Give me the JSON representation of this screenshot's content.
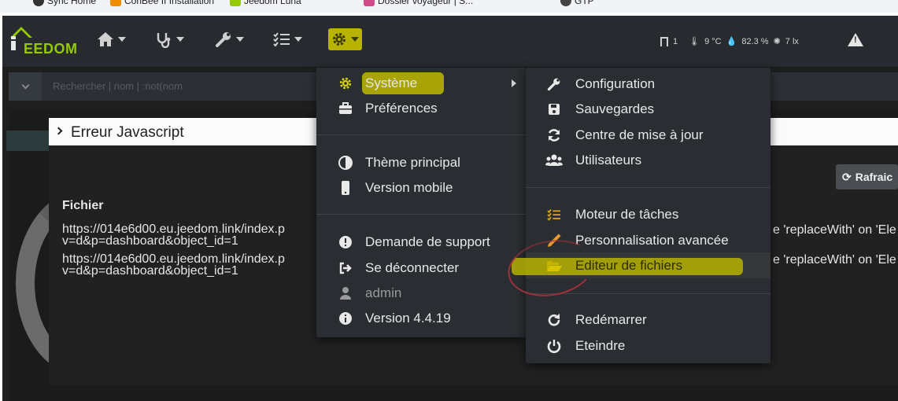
{
  "bookmarks": {
    "items": [
      {
        "label": "Sync Home"
      },
      {
        "label": "ConBee II Installation"
      },
      {
        "label": "Jeedom Luna"
      },
      {
        "label": "Dossier voyageur | S..."
      },
      {
        "label": "GTP"
      }
    ]
  },
  "navbar": {
    "logo": "EEDOM",
    "status": {
      "doors": "1",
      "temperature": "9 °C",
      "humidity": "82.3 %",
      "lux": "7 lx"
    }
  },
  "search": {
    "placeholder": "Rechercher | nom | :not(nom"
  },
  "modal": {
    "title": "Erreur Javascript",
    "refresh_label": "Rafraic",
    "fichier_label": "Fichier",
    "rows": [
      {
        "file": "https://014e6d00.eu.jeedom.link/index.p\nv=d&p=dashboard&object_id=1",
        "error": "e 'replaceWith' on 'Ele"
      },
      {
        "file": "https://014e6d00.eu.jeedom.link/index.p\nv=d&p=dashboard&object_id=1",
        "error": "e 'replaceWith' on 'Ele"
      }
    ]
  },
  "menu_left": {
    "items": [
      {
        "label": "Système",
        "icon": "gear-icon"
      },
      {
        "label": "Préférences",
        "icon": "briefcase-icon"
      },
      {
        "label": "Thème principal",
        "icon": "contrast-icon"
      },
      {
        "label": "Version mobile",
        "icon": "mobile-icon"
      },
      {
        "label": "Demande de support",
        "icon": "exclamation-circle-icon"
      },
      {
        "label": "Se déconnecter",
        "icon": "sign-out-icon"
      },
      {
        "label": "admin",
        "icon": "user-icon"
      },
      {
        "label": "Version 4.4.19",
        "icon": "info-circle-icon"
      }
    ]
  },
  "menu_right": {
    "items": [
      {
        "label": "Configuration",
        "icon": "wrench-icon"
      },
      {
        "label": "Sauvegardes",
        "icon": "floppy-icon"
      },
      {
        "label": "Centre de mise à jour",
        "icon": "refresh-icon"
      },
      {
        "label": "Utilisateurs",
        "icon": "users-icon"
      },
      {
        "label": "Moteur de tâches",
        "icon": "tasks-icon"
      },
      {
        "label": "Personnalisation avancée",
        "icon": "pencil-icon"
      },
      {
        "label": "Editeur de fichiers",
        "icon": "folder-open-icon"
      },
      {
        "label": "Redémarrer",
        "icon": "redo-icon"
      },
      {
        "label": "Eteindre",
        "icon": "power-icon"
      }
    ]
  },
  "colors": {
    "highlight": "#b8b300",
    "accent": "#94ca02",
    "menu_bg": "#2a2d31"
  }
}
